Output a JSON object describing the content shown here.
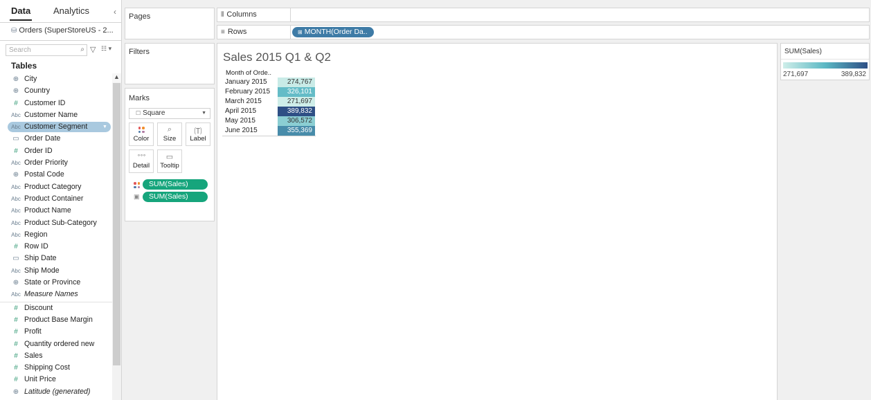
{
  "data_pane": {
    "tab_data": "Data",
    "tab_analytics": "Analytics",
    "datasource": "Orders (SuperStoreUS - 2...",
    "search_placeholder": "Search",
    "tables_heading": "Tables",
    "fields": [
      {
        "name": "City",
        "icon": "globe-icon"
      },
      {
        "name": "Country",
        "icon": "globe-icon"
      },
      {
        "name": "Customer ID",
        "icon": "number-icon"
      },
      {
        "name": "Customer Name",
        "icon": "string-icon"
      },
      {
        "name": "Customer Segment",
        "icon": "string-icon"
      },
      {
        "name": "Order Date",
        "icon": "date-icon"
      },
      {
        "name": "Order ID",
        "icon": "number-icon"
      },
      {
        "name": "Order Priority",
        "icon": "string-icon"
      },
      {
        "name": "Postal Code",
        "icon": "globe-icon"
      },
      {
        "name": "Product Category",
        "icon": "string-icon"
      },
      {
        "name": "Product Container",
        "icon": "string-icon"
      },
      {
        "name": "Product Name",
        "icon": "string-icon"
      },
      {
        "name": "Product Sub-Category",
        "icon": "string-icon"
      },
      {
        "name": "Region",
        "icon": "string-icon"
      },
      {
        "name": "Row ID",
        "icon": "number-icon"
      },
      {
        "name": "Ship Date",
        "icon": "date-icon"
      },
      {
        "name": "Ship Mode",
        "icon": "string-icon"
      },
      {
        "name": "State or Province",
        "icon": "globe-icon"
      },
      {
        "name": "Measure Names",
        "icon": "string-icon"
      },
      {
        "name": "Discount",
        "icon": "number-icon"
      },
      {
        "name": "Product Base Margin",
        "icon": "number-icon"
      },
      {
        "name": "Profit",
        "icon": "number-icon"
      },
      {
        "name": "Quantity ordered new",
        "icon": "number-icon"
      },
      {
        "name": "Sales",
        "icon": "number-icon"
      },
      {
        "name": "Shipping Cost",
        "icon": "number-icon"
      },
      {
        "name": "Unit Price",
        "icon": "number-icon"
      },
      {
        "name": "Latitude (generated)",
        "icon": "globe-icon"
      }
    ],
    "selected_field": "Customer Segment"
  },
  "shelves": {
    "pages_title": "Pages",
    "filters_title": "Filters",
    "columns_label": "Columns",
    "rows_label": "Rows",
    "rows_pill": "MONTH(Order Da.."
  },
  "marks": {
    "title": "Marks",
    "mark_type": "Square",
    "buttons": {
      "color": "Color",
      "size": "Size",
      "label": "Label",
      "detail": "Detail",
      "tooltip": "Tooltip"
    },
    "pills": [
      {
        "label": "SUM(Sales)",
        "encoding": "color"
      },
      {
        "label": "SUM(Sales)",
        "encoding": "label"
      }
    ]
  },
  "view": {
    "title": "Sales 2015 Q1 & Q2",
    "header": "Month of Orde.."
  },
  "chart_data": {
    "type": "heatmap",
    "title": "Sales 2015 Q1 & Q2",
    "xlabel": "",
    "ylabel": "Month of Orde..",
    "categories": [
      "January 2015",
      "February 2015",
      "March 2015",
      "April 2015",
      "May 2015",
      "June 2015"
    ],
    "values": [
      274767,
      326101,
      271697,
      389832,
      306572,
      355369
    ],
    "value_labels": [
      "274,767",
      "326,101",
      "271,697",
      "389,832",
      "306,572",
      "355,369"
    ],
    "color_range": [
      271697,
      389832
    ],
    "color_low": "#cfeee9",
    "color_mid": "#5bb8c4",
    "color_high": "#2e4f85",
    "measure": "SUM(Sales)"
  },
  "legend": {
    "title": "SUM(Sales)",
    "min_label": "271,697",
    "max_label": "389,832"
  },
  "colors": {
    "pill_dimension": "#3e7ba6",
    "pill_measure": "#16a57c",
    "selection": "#a9c9df"
  }
}
